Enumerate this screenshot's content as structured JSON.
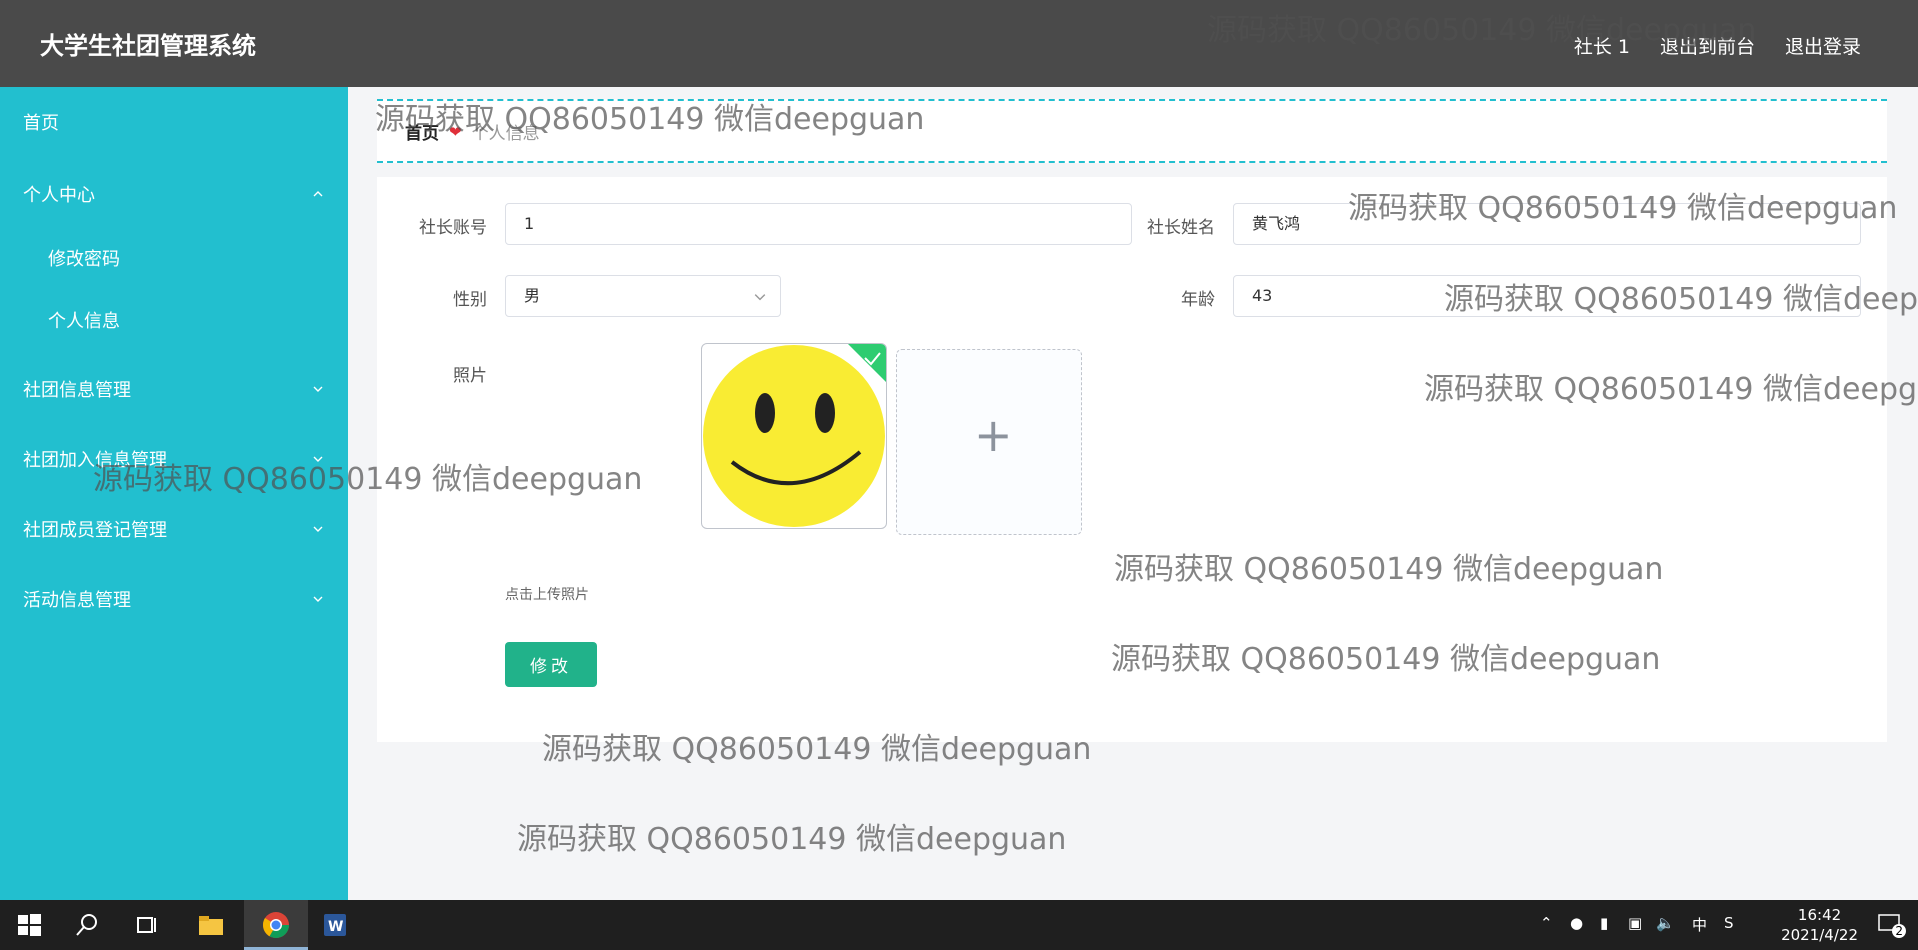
{
  "header": {
    "title": "大学生社团管理系统",
    "user": "社长 1",
    "exit_front": "退出到前台",
    "logout": "退出登录"
  },
  "sidebar": {
    "items": [
      {
        "label": "首页"
      },
      {
        "label": "个人中心",
        "expanded": true
      },
      {
        "label": "修改密码",
        "sub": true
      },
      {
        "label": "个人信息",
        "sub": true
      },
      {
        "label": "社团信息管理"
      },
      {
        "label": "社团加入信息管理"
      },
      {
        "label": "社团成员登记管理"
      },
      {
        "label": "活动信息管理"
      }
    ]
  },
  "breadcrumb": {
    "home": "首页",
    "current": "个人信息"
  },
  "form": {
    "account_label": "社长账号",
    "account_value": "1",
    "name_label": "社长姓名",
    "name_value": "黄飞鸿",
    "gender_label": "性别",
    "gender_value": "男",
    "age_label": "年龄",
    "age_value": "43",
    "photo_label": "照片",
    "upload_hint": "点击上传照片",
    "submit_label": "修改"
  },
  "watermark": "源码获取 QQ86050149 微信deepguan",
  "taskbar": {
    "ime": "中",
    "time": "16:42",
    "date": "2021/4/22",
    "notifications": "2"
  },
  "colors": {
    "sidebar": "#22bfcf",
    "topbar": "#4a4a4a",
    "primary_button": "#21b28a"
  }
}
